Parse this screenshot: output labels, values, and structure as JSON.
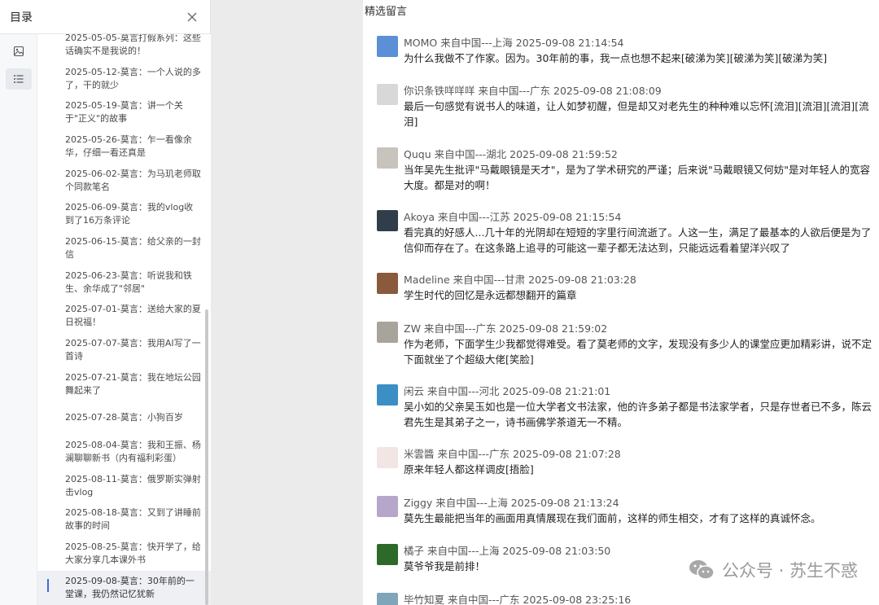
{
  "sidebar": {
    "title": "目录",
    "toc": [
      "2025-05-05-莫言打假系列：这些话确实不是我说的！",
      "2025-05-12-莫言：一个人说的多了，干的就少",
      "2025-05-19-莫言：讲一个关于\"正义\"的故事",
      "2025-05-26-莫言：乍一看像余华，仔细一看还真是",
      "2025-06-02-莫言：为马玑老师取个同款笔名",
      "2025-06-09-莫言：我的vlog收到了16万条评论",
      "2025-06-15-莫言：给父亲的一封信",
      "2025-06-23-莫言：听说我和铁生、余华成了\"邻居\"",
      "2025-07-01-莫言：送给大家的夏日祝福！",
      "2025-07-07-莫言：我用AI写了一首诗",
      "2025-07-21-莫言：我在地坛公园舞起来了",
      "2025-07-28-莫言：小狗百岁",
      "2025-08-04-莫言：我和王振、杨澜聊聊新书（内有福利彩蛋）",
      "2025-08-11-莫言：俄罗斯实弹射击vlog",
      "2025-08-18-莫言：又到了讲睡前故事的时间",
      "2025-08-25-莫言：快开学了，给大家分享几本课外书",
      "2025-09-08-莫言：30年前的一堂课，我仍然记忆犹新"
    ]
  },
  "main": {
    "title": "精选留言",
    "comments": [
      {
        "name": "MOMO",
        "meta": "来自中国---上海 2025-09-08 21:14:54",
        "text": "为什么我做不了作家。因为。30年前的事，我一点也想不起来[破涕为笑][破涕为笑][破涕为笑]",
        "avatar": "#5b8fd6"
      },
      {
        "name": "你识条铁咩咩咩",
        "meta": "来自中国---广东 2025-09-08 21:08:09",
        "text": "最后一句感觉有说书人的味道，让人如梦初醒，但是却又对老先生的种种难以忘怀[流泪][流泪][流泪][流泪]",
        "avatar": "#d8d8d8"
      },
      {
        "name": "Ququ",
        "meta": "来自中国---湖北 2025-09-08 21:59:52",
        "text": "当年吴先生批评\"马戴眼镜是天才\"，是为了学术研究的严谨；后来说\"马戴眼镜又何妨\"是对年轻人的宽容大度。都是对的啊！",
        "avatar": "#c9c3bd"
      },
      {
        "name": "Akoya",
        "meta": "来自中国---江苏 2025-09-08 21:15:54",
        "text": "看完真的好感人...几十年的光阴却在短短的字里行间流逝了。人这一生，满足了最基本的人欲后便是为了信仰而存在了。在这条路上追寻的可能这一辈子都无法达到，只能远远看着望洋兴叹了",
        "avatar": "#2f3e4a"
      },
      {
        "name": "Madeline",
        "meta": "来自中国---甘肃 2025-09-08 21:03:28",
        "text": "学生时代的回忆是永远都想翻开的篇章",
        "avatar": "#8a5a3c"
      },
      {
        "name": "ZW",
        "meta": "来自中国---广东 2025-09-08 21:59:02",
        "text": "作为老师，下面学生少我都觉得难受。看了莫老师的文字，发现没有多少人的课堂应更加精彩讲，说不定下面就坐了个超级大佬[笑脸]",
        "avatar": "#a8a49c"
      },
      {
        "name": "闲云",
        "meta": "来自中国---河北 2025-09-08 21:21:01",
        "text": "吴小如的父亲吴玉如也是一位大学者文书法家，他的许多弟子都是书法家学者，只是存世者已不多，陈云君先生是其弟子之一，诗书画佛学茶道无一不精。",
        "avatar": "#3b8fc4"
      },
      {
        "name": "米雲醬",
        "meta": "来自中国---广东 2025-09-08 21:07:28",
        "text": "原来年轻人都这样调皮[捂脸]",
        "avatar": "#f1e6e3"
      },
      {
        "name": "Ziggy",
        "meta": "来自中国---上海 2025-09-08 21:13:24",
        "text": "莫先生最能把当年的画面用真情展现在我们面前，这样的师生相交，才有了这样的真诚怀念。",
        "avatar": "#b6a6c9"
      },
      {
        "name": "橘子",
        "meta": "来自中国---上海 2025-09-08 21:03:50",
        "text": "莫爷爷我是前排！",
        "avatar": "#2d6a2a"
      },
      {
        "name": "毕竹知夏",
        "meta": "来自中国---广东 2025-09-08 23:25:16",
        "text": "",
        "avatar": "#7fa6b8"
      }
    ]
  },
  "watermark": {
    "text": "公众号 · 苏生不惑"
  }
}
